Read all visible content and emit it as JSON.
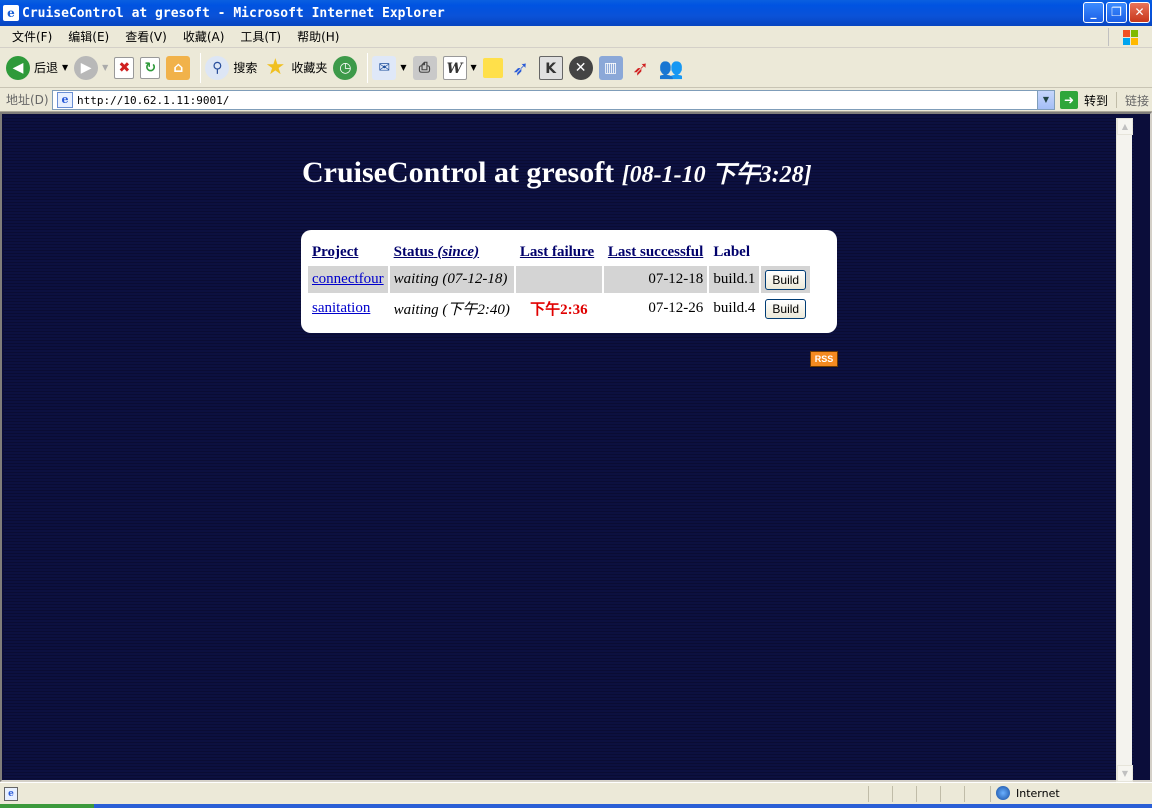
{
  "window": {
    "title": "CruiseControl at gresoft - Microsoft Internet Explorer",
    "buttons": {
      "minimize": "_",
      "restore": "❐",
      "close": "✕"
    }
  },
  "menu": [
    "文件(F)",
    "编辑(E)",
    "查看(V)",
    "收藏(A)",
    "工具(T)",
    "帮助(H)"
  ],
  "toolbar": {
    "back_label": "后退",
    "search_label": "搜索",
    "favorites_label": "收藏夹",
    "icons": [
      "back-icon",
      "forward-icon",
      "stop-icon",
      "refresh-icon",
      "home-icon",
      "search-icon",
      "favorites-icon",
      "history-icon",
      "mail-icon",
      "print-icon",
      "edit-icon",
      "note-icon",
      "messenger-icon",
      "toolbar-k-icon",
      "close-circle-icon",
      "research-icon",
      "bird-icon",
      "contacts-icon"
    ]
  },
  "address": {
    "label": "地址(D)",
    "url": "http://10.62.1.11:9001/",
    "go_label": "转到",
    "links_label": "链接"
  },
  "page": {
    "title": "CruiseControl at gresoft",
    "timestamp": "[08-1-10  下午3:28]",
    "columns": {
      "project": "Project",
      "status": "Status",
      "since": "(since)",
      "last_failure": "Last failure",
      "last_successful": "Last successful",
      "label": "Label"
    },
    "rows": [
      {
        "project": "connectfour",
        "status": "waiting (07-12-18)",
        "last_failure": "",
        "last_successful": "07-12-18",
        "label": "build.1",
        "action": "Build"
      },
      {
        "project": "sanitation",
        "status": "waiting (下午2:40)",
        "last_failure": "下午2:36",
        "last_successful": "07-12-26",
        "label": "build.4",
        "action": "Build"
      }
    ],
    "rss_label": "RSS"
  },
  "statusbar": {
    "zone": "Internet"
  },
  "colors": {
    "page_background": "#0c1040",
    "failure_text": "#e00000",
    "header_link": "#00006b",
    "title_bar": "#0053e1"
  }
}
